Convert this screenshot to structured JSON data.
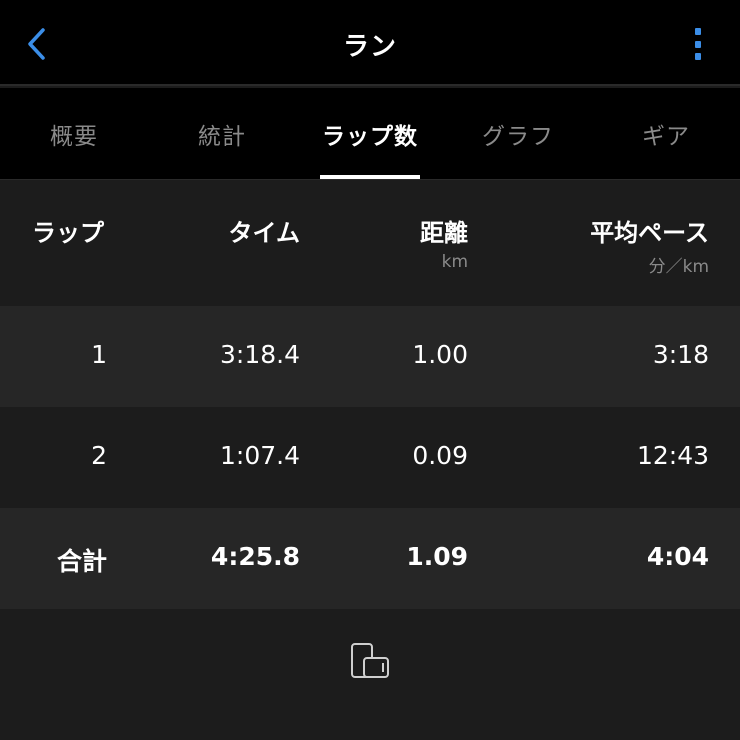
{
  "header": {
    "title": "ラン",
    "back_icon": "chevron-left-icon",
    "more_icon": "more-vertical-icon",
    "accent_color": "#3b8ee8"
  },
  "tabs": [
    {
      "label": "概要",
      "active": false
    },
    {
      "label": "統計",
      "active": false
    },
    {
      "label": "ラップ数",
      "active": true
    },
    {
      "label": "グラフ",
      "active": false
    },
    {
      "label": "ギア",
      "active": false
    }
  ],
  "table": {
    "headers": {
      "lap": "ラップ",
      "time": "タイム",
      "distance": "距離",
      "distance_unit": "km",
      "pace": "平均ペース",
      "pace_unit": "分／km"
    },
    "rows": [
      {
        "lap": "1",
        "time": "3:18.4",
        "distance": "1.00",
        "pace": "3:18"
      },
      {
        "lap": "2",
        "time": "1:07.4",
        "distance": "0.09",
        "pace": "12:43"
      }
    ],
    "total": {
      "lap": "合計",
      "time": "4:25.8",
      "distance": "1.09",
      "pace": "4:04"
    }
  },
  "footer": {
    "rotate_icon": "rotate-device-icon"
  }
}
